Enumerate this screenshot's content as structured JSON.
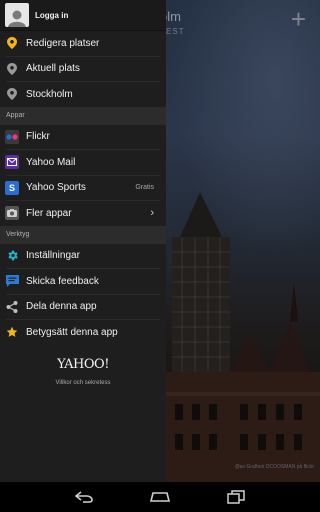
{
  "background_app": {
    "title": "olm",
    "subtitle": "EST",
    "add_label": "+",
    "photo_credit": "@av Grafheir DCOOSMAN på flickr"
  },
  "drawer": {
    "login_label": "Logga in",
    "locations": [
      {
        "label": "Redigera platser",
        "icon": "pin-icon",
        "color": "#f6b41a"
      },
      {
        "label": "Aktuell plats",
        "icon": "pin-icon",
        "color": "#9a9a9a"
      },
      {
        "label": "Stockholm",
        "icon": "pin-icon",
        "color": "#9a9a9a"
      }
    ],
    "apps_header": "Appar",
    "apps": [
      {
        "label": "Flickr",
        "icon": "flickr-icon"
      },
      {
        "label": "Yahoo Mail",
        "icon": "yahoo-mail-icon"
      },
      {
        "label": "Yahoo Sports",
        "icon": "yahoo-sports-icon",
        "extra": "Gratis"
      },
      {
        "label": "Fler appar",
        "icon": "more-apps-icon",
        "chevron": "›"
      }
    ],
    "tools_header": "Verktyg",
    "tools": [
      {
        "label": "Inställningar",
        "icon": "gear-icon"
      },
      {
        "label": "Skicka feedback",
        "icon": "feedback-icon"
      },
      {
        "label": "Dela denna app",
        "icon": "share-icon"
      },
      {
        "label": "Betygsätt denna app",
        "icon": "star-icon"
      }
    ],
    "brand": "YAHOO!",
    "terms": "Villkor och sekretess"
  },
  "colors": {
    "drawer_bg": "#1e1e1e",
    "section_bg": "#2c2c2c",
    "accent_yellow": "#f6b41a",
    "settings_teal": "#1fb6c8",
    "feedback_blue": "#2e7bd6",
    "mail_purple": "#5b2ea6",
    "sports_blue": "#2a6fcf"
  },
  "nav": {
    "back": "back-icon",
    "home": "home-icon",
    "recents": "recents-icon"
  }
}
